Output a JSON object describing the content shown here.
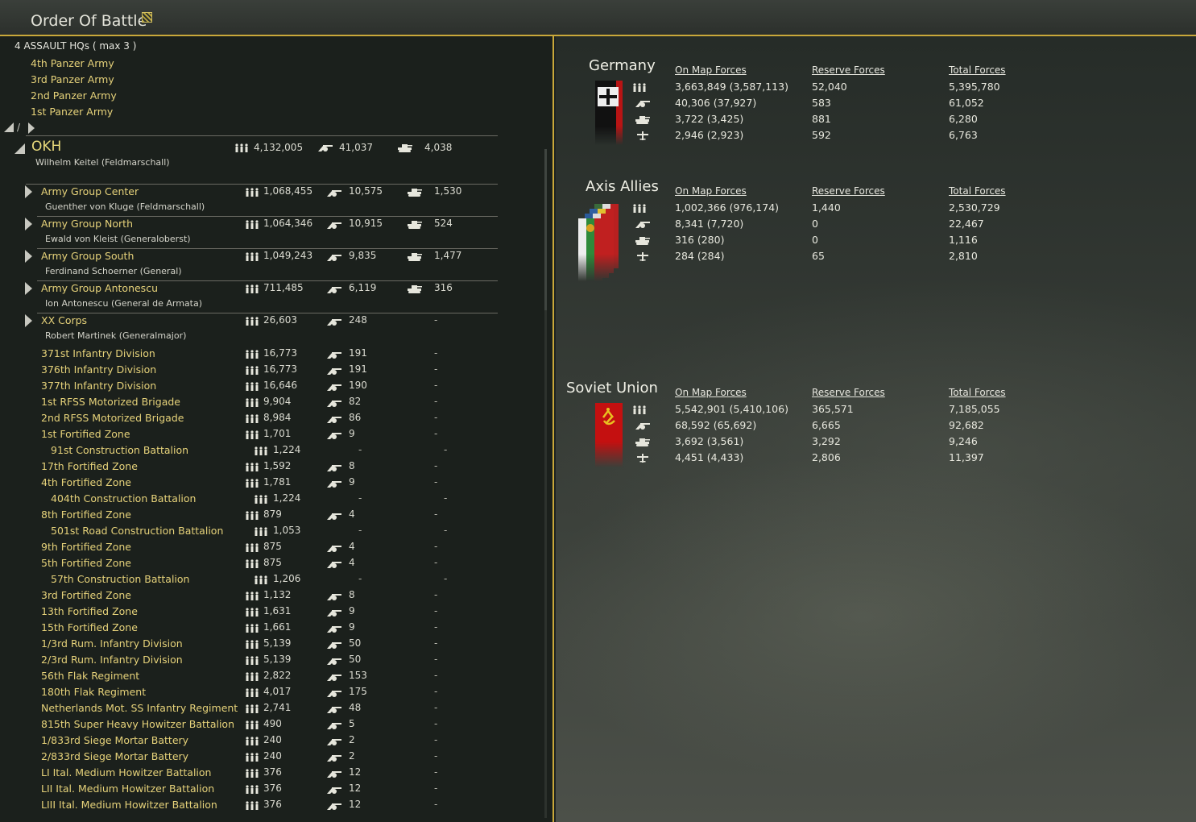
{
  "window": {
    "title": "Order Of Battle",
    "title_icon": "report-icon"
  },
  "hq_panel": {
    "title": "4 ASSAULT HQs ( max 3 )",
    "items": [
      "4th Panzer Army",
      "3rd Panzer Army",
      "2nd Panzer Army",
      "1st Panzer Army"
    ],
    "nav_separator": "/"
  },
  "okh": {
    "name": "OKH",
    "commander": "Wilhelm Keitel  (Feldmarschall)",
    "men": "4,132,005",
    "guns": "41,037",
    "tanks": "4,038"
  },
  "army_groups": [
    {
      "name": "Army Group Center",
      "commander": "Guenther von Kluge  (Feldmarschall)",
      "men": "1,068,455",
      "guns": "10,575",
      "tanks": "1,530"
    },
    {
      "name": "Army Group North",
      "commander": "Ewald von Kleist  (Generaloberst)",
      "men": "1,064,346",
      "guns": "10,915",
      "tanks": "524"
    },
    {
      "name": "Army Group South",
      "commander": "Ferdinand Schoerner  (General)",
      "men": "1,049,243",
      "guns": "9,835",
      "tanks": "1,477"
    },
    {
      "name": "Army Group Antonescu",
      "commander": "Ion Antonescu  (General de Armata)",
      "men": "711,485",
      "guns": "6,119",
      "tanks": "316"
    },
    {
      "name": "XX Corps",
      "commander": "Robert Martinek  (Generalmajor)",
      "men": "26,603",
      "guns": "248",
      "tanks": "-"
    }
  ],
  "units": [
    {
      "name": "371st Infantry Division",
      "men": "16,773",
      "guns": "191",
      "tanks": "-",
      "indent": false
    },
    {
      "name": "376th Infantry Division",
      "men": "16,773",
      "guns": "191",
      "tanks": "-",
      "indent": false
    },
    {
      "name": "377th Infantry Division",
      "men": "16,646",
      "guns": "190",
      "tanks": "-",
      "indent": false
    },
    {
      "name": "1st RFSS Motorized Brigade",
      "men": "9,904",
      "guns": "82",
      "tanks": "-",
      "indent": false
    },
    {
      "name": "2nd RFSS Motorized Brigade",
      "men": "8,984",
      "guns": "86",
      "tanks": "-",
      "indent": false
    },
    {
      "name": "1st Fortified Zone",
      "men": "1,701",
      "guns": "9",
      "tanks": "-",
      "indent": false
    },
    {
      "name": "91st Construction Battalion",
      "men": "1,224",
      "guns": "-",
      "tanks": "-",
      "indent": true
    },
    {
      "name": "17th Fortified Zone",
      "men": "1,592",
      "guns": "8",
      "tanks": "-",
      "indent": false
    },
    {
      "name": "4th Fortified Zone",
      "men": "1,781",
      "guns": "9",
      "tanks": "-",
      "indent": false
    },
    {
      "name": "404th Construction Battalion",
      "men": "1,224",
      "guns": "-",
      "tanks": "-",
      "indent": true
    },
    {
      "name": "8th Fortified Zone",
      "men": "879",
      "guns": "4",
      "tanks": "-",
      "indent": false
    },
    {
      "name": "501st Road Construction Battalion",
      "men": "1,053",
      "guns": "-",
      "tanks": "-",
      "indent": true
    },
    {
      "name": "9th Fortified Zone",
      "men": "875",
      "guns": "4",
      "tanks": "-",
      "indent": false
    },
    {
      "name": "5th Fortified Zone",
      "men": "875",
      "guns": "4",
      "tanks": "-",
      "indent": false
    },
    {
      "name": "57th Construction Battalion",
      "men": "1,206",
      "guns": "-",
      "tanks": "-",
      "indent": true
    },
    {
      "name": "3rd Fortified Zone",
      "men": "1,132",
      "guns": "8",
      "tanks": "-",
      "indent": false
    },
    {
      "name": "13th Fortified Zone",
      "men": "1,631",
      "guns": "9",
      "tanks": "-",
      "indent": false
    },
    {
      "name": "15th Fortified Zone",
      "men": "1,661",
      "guns": "9",
      "tanks": "-",
      "indent": false
    },
    {
      "name": "1/3rd Rum. Infantry Division",
      "men": "5,139",
      "guns": "50",
      "tanks": "-",
      "indent": false
    },
    {
      "name": "2/3rd Rum. Infantry Division",
      "men": "5,139",
      "guns": "50",
      "tanks": "-",
      "indent": false
    },
    {
      "name": "56th Flak Regiment",
      "men": "2,822",
      "guns": "153",
      "tanks": "-",
      "indent": false
    },
    {
      "name": "180th Flak Regiment",
      "men": "4,017",
      "guns": "175",
      "tanks": "-",
      "indent": false
    },
    {
      "name": "Netherlands Mot. SS Infantry Regiment",
      "men": "2,741",
      "guns": "48",
      "tanks": "-",
      "indent": false
    },
    {
      "name": "815th Super Heavy Howitzer Battalion",
      "men": "490",
      "guns": "5",
      "tanks": "-",
      "indent": false
    },
    {
      "name": "1/833rd Siege Mortar Battery",
      "men": "240",
      "guns": "2",
      "tanks": "-",
      "indent": false
    },
    {
      "name": "2/833rd Siege Mortar Battery",
      "men": "240",
      "guns": "2",
      "tanks": "-",
      "indent": false
    },
    {
      "name": "LI Ital. Medium Howitzer Battalion",
      "men": "376",
      "guns": "12",
      "tanks": "-",
      "indent": false
    },
    {
      "name": "LII Ital. Medium Howitzer Battalion",
      "men": "376",
      "guns": "12",
      "tanks": "-",
      "indent": false
    },
    {
      "name": "LIII Ital. Medium Howitzer Battalion",
      "men": "376",
      "guns": "12",
      "tanks": "-",
      "indent": false
    }
  ],
  "summary": {
    "column_headers": [
      "On Map Forces",
      "Reserve Forces",
      "Total Forces"
    ],
    "nations": [
      {
        "name": "Germany",
        "flag": "german-war-flag",
        "rows": [
          [
            "3,663,849 (3,587,113)",
            "52,040",
            "5,395,780"
          ],
          [
            "40,306 (37,927)",
            "583",
            "61,052"
          ],
          [
            "3,722 (3,425)",
            "881",
            "6,280"
          ],
          [
            "2,946 (2,923)",
            "592",
            "6,763"
          ]
        ]
      },
      {
        "name": "Axis Allies",
        "flag": "axis-allies-flags",
        "rows": [
          [
            "1,002,366 (976,174)",
            "1,440",
            "2,530,729"
          ],
          [
            "8,341 (7,720)",
            "0",
            "22,467"
          ],
          [
            "316 (280)",
            "0",
            "1,116"
          ],
          [
            "284 (284)",
            "65",
            "2,810"
          ]
        ]
      },
      {
        "name": "Soviet Union",
        "flag": "soviet-flag",
        "rows": [
          [
            "5,542,901 (5,410,106)",
            "365,571",
            "7,185,055"
          ],
          [
            "68,592 (65,692)",
            "6,665",
            "92,682"
          ],
          [
            "3,692 (3,561)",
            "3,292",
            "9,246"
          ],
          [
            "4,451 (4,433)",
            "2,806",
            "11,397"
          ]
        ]
      }
    ],
    "row_icons": [
      "men-icon",
      "gun-icon",
      "tank-icon",
      "aircraft-icon"
    ]
  },
  "colors": {
    "accent": "#c9a83a",
    "unit_text": "#e6d27a",
    "background": "#1b201c"
  }
}
